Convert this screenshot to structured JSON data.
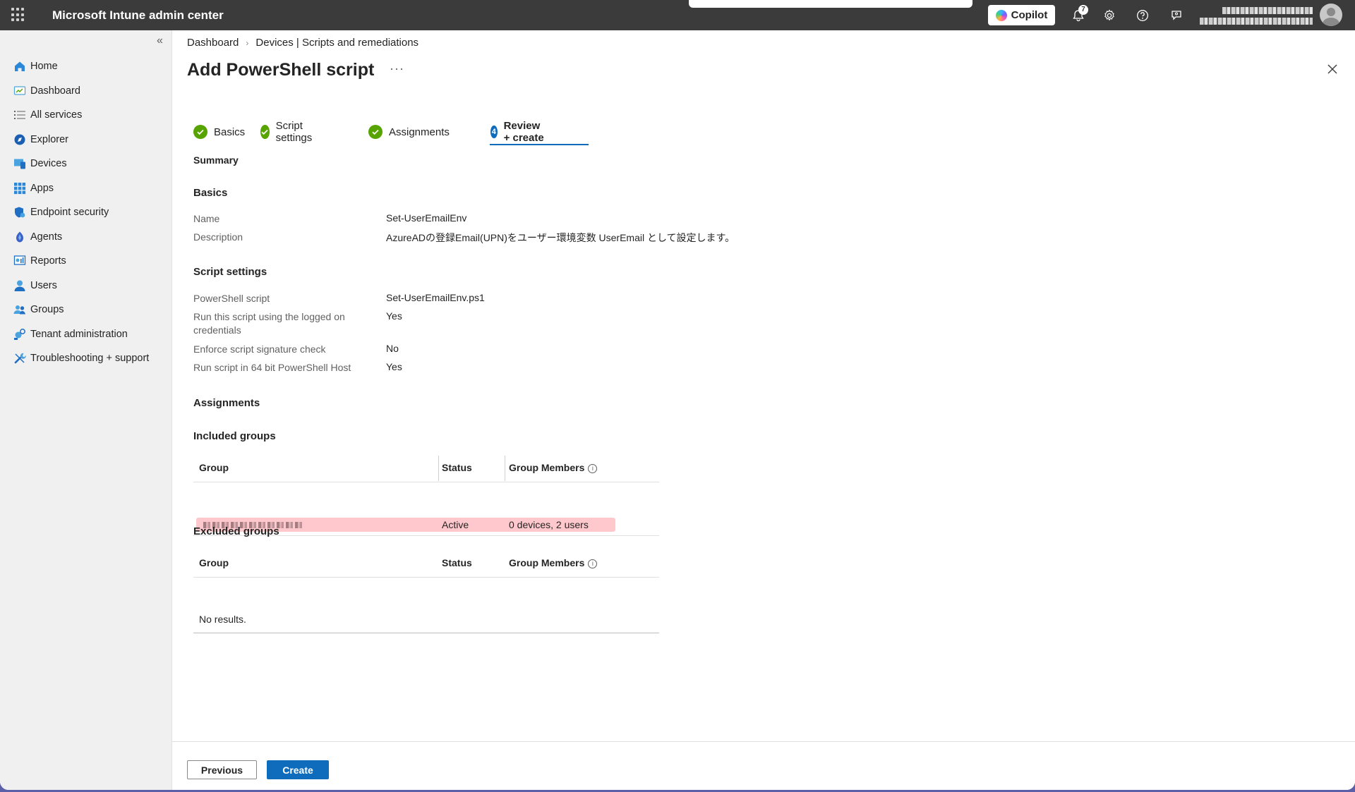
{
  "topbar": {
    "title": "Microsoft Intune admin center",
    "copilot_label": "Copilot",
    "notification_count": "7"
  },
  "sidebar": {
    "items": [
      {
        "label": "Home",
        "icon": "home-icon"
      },
      {
        "label": "Dashboard",
        "icon": "dashboard-icon"
      },
      {
        "label": "All services",
        "icon": "list-icon"
      },
      {
        "label": "Explorer",
        "icon": "explorer-icon"
      },
      {
        "label": "Devices",
        "icon": "devices-icon"
      },
      {
        "label": "Apps",
        "icon": "apps-icon"
      },
      {
        "label": "Endpoint security",
        "icon": "shield-icon"
      },
      {
        "label": "Agents",
        "icon": "agents-icon"
      },
      {
        "label": "Reports",
        "icon": "reports-icon"
      },
      {
        "label": "Users",
        "icon": "user-icon"
      },
      {
        "label": "Groups",
        "icon": "groups-icon"
      },
      {
        "label": "Tenant administration",
        "icon": "tenant-icon"
      },
      {
        "label": "Troubleshooting + support",
        "icon": "wrench-icon"
      }
    ]
  },
  "breadcrumb": {
    "items": [
      "Dashboard",
      "Devices | Scripts and remediations"
    ]
  },
  "page": {
    "title": "Add PowerShell script"
  },
  "wizard": {
    "steps": [
      {
        "label": "Basics",
        "state": "complete"
      },
      {
        "label": "Script settings",
        "state": "complete"
      },
      {
        "label": "Assignments",
        "state": "complete"
      },
      {
        "label": "Review + create",
        "state": "current",
        "number": "4"
      }
    ]
  },
  "summary": {
    "heading": "Summary",
    "basics": {
      "heading": "Basics",
      "name_label": "Name",
      "name_value": "Set-UserEmailEnv",
      "description_label": "Description",
      "description_value": "AzureADの登録Email(UPN)をユーザー環境変数 UserEmail として設定します。"
    },
    "script_settings": {
      "heading": "Script settings",
      "rows": [
        {
          "label": "PowerShell script",
          "value": "Set-UserEmailEnv.ps1"
        },
        {
          "label": "Run this script using the logged on credentials",
          "value": "Yes"
        },
        {
          "label": "Enforce script signature check",
          "value": "No"
        },
        {
          "label": "Run script in 64 bit PowerShell Host",
          "value": "Yes"
        }
      ]
    },
    "assignments": {
      "heading": "Assignments",
      "included": {
        "heading": "Included groups",
        "columns": [
          "Group",
          "Status",
          "Group Members"
        ],
        "rows": [
          {
            "status": "Active",
            "members": "0 devices, 2 users"
          }
        ]
      },
      "excluded": {
        "heading": "Excluded groups",
        "columns": [
          "Group",
          "Status",
          "Group Members"
        ],
        "empty_text": "No results."
      }
    }
  },
  "footer": {
    "previous_label": "Previous",
    "create_label": "Create"
  },
  "colors": {
    "accent": "#0f6cbd",
    "success": "#57a300",
    "topbar": "#3b3b3b",
    "highlight": "#ffc8cd"
  }
}
